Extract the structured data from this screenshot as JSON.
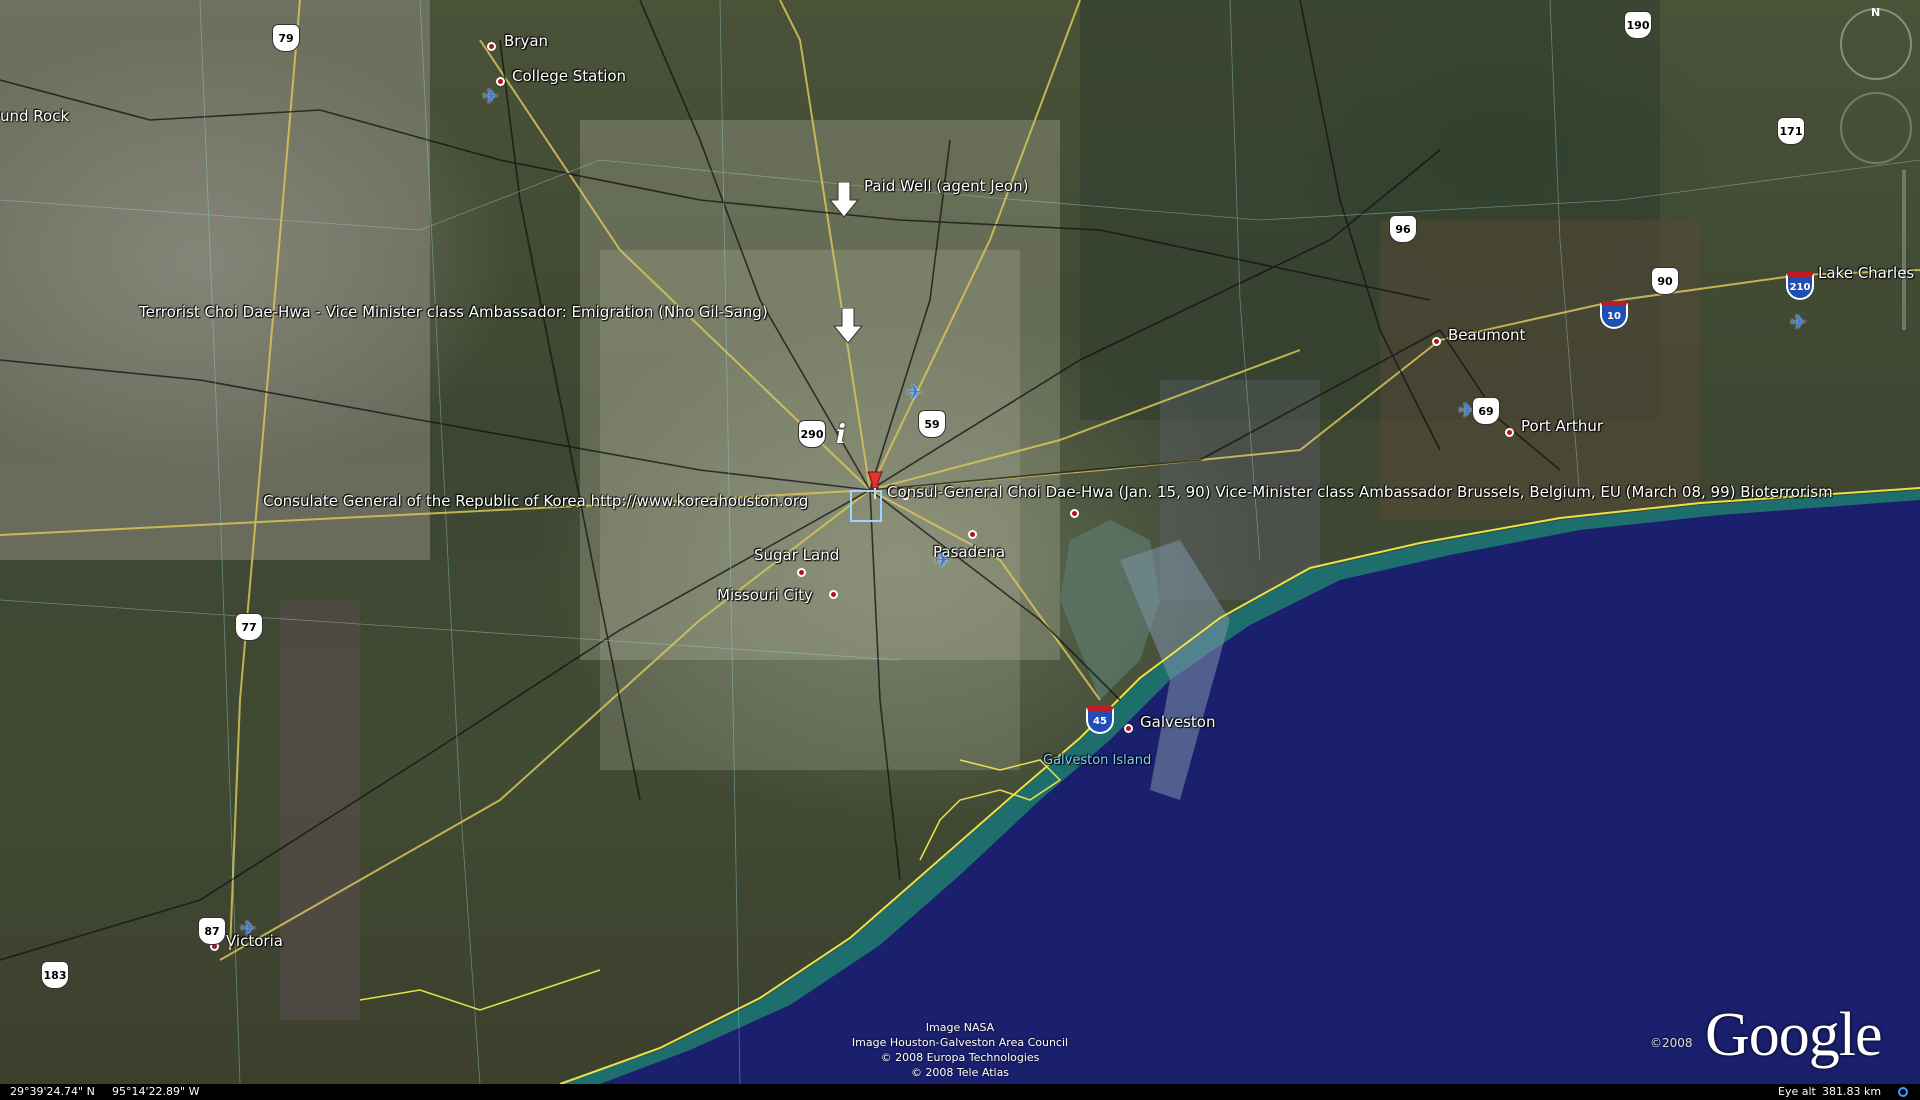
{
  "map": {
    "places": [
      {
        "name": "Bryan"
      },
      {
        "name": "College Station"
      },
      {
        "name": "und Rock"
      },
      {
        "name": "Beaumont"
      },
      {
        "name": "Port Arthur"
      },
      {
        "name": "Lake Charles"
      },
      {
        "name": "Sugar Land"
      },
      {
        "name": "Missouri City"
      },
      {
        "name": "Pasadena"
      },
      {
        "name": "Galveston"
      },
      {
        "name": "Victoria"
      },
      {
        "name": "Galveston Island"
      }
    ],
    "placemarks": {
      "paid_well": "Paid Well (agent Jeon)",
      "terrorist": "Terrorist Choi Dae-Hwa - Vice Minister class Ambassador: Emigration (Nho Gil-Sang)",
      "consulate": "Consulate General of the Republic of Korea http://www.koreahouston.org",
      "consul_general": "Consul-General Choi Dae-Hwa (Jan. 15, 90) Vice-Minister class Ambassador Brussels, Belgium, EU (March 08, 99) Bioterrorism"
    },
    "route_shields": {
      "us": [
        "79",
        "190",
        "171",
        "96",
        "90",
        "290",
        "59",
        "77",
        "87",
        "183"
      ],
      "interstate": [
        "10",
        "45",
        "210"
      ],
      "us_partial": "69"
    },
    "compass_label": "N"
  },
  "credits": [
    "Image NASA",
    "Image Houston-Galveston Area Council",
    "© 2008 Europa Technologies",
    "© 2008 Tele Atlas"
  ],
  "branding": {
    "year": "©2008",
    "logo": "Google"
  },
  "status": {
    "latitude": "29°39'24.74\" N",
    "longitude": "95°14'22.89\" W",
    "eye_alt_label": "Eye alt",
    "eye_alt_value": "381.83 km"
  },
  "colors": {
    "gulf": "#1a1f6e",
    "road": "#d9c55a",
    "coast": "#e8e24a",
    "marker": "#b0121b"
  }
}
